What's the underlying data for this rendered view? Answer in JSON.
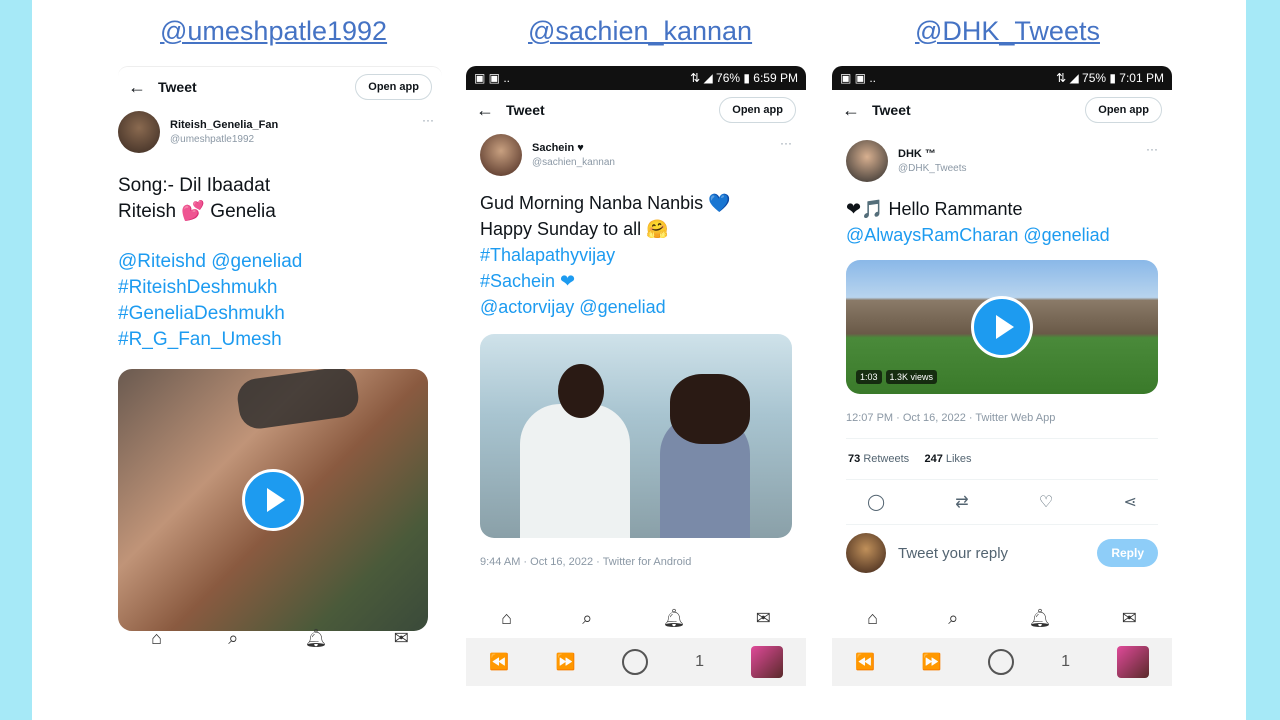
{
  "headings": [
    "@umeshpatle1992",
    "@sachien_kannan",
    "@DHK_Tweets"
  ],
  "panels": [
    {
      "status": null,
      "toolbar": {
        "back": "←",
        "title": "Tweet",
        "open_app": "Open app"
      },
      "author": {
        "name": "Riteish_Genelia_Fan",
        "handle": "@umeshpatle1992"
      },
      "text_lines": [
        "Song:- Dil Ibaadat",
        "Riteish 💕 Genelia"
      ],
      "link_lines": [
        "@Riteishd @geneliad",
        "#RiteishDeshmukh",
        "#GeneliaDeshmukh",
        "#R_G_Fan_Umesh"
      ]
    },
    {
      "status": {
        "left": "▣ ▣ ..",
        "right": "⇅ ◢ 76% ▮ 6:59 PM"
      },
      "toolbar": {
        "back": "←",
        "title": "Tweet",
        "open_app": "Open app"
      },
      "author": {
        "name": "Sachein ♥",
        "handle": "@sachien_kannan"
      },
      "text_lines": [
        "Gud Morning Nanba Nanbis 💙",
        "Happy Sunday to all 🤗"
      ],
      "link_lines": [
        "#Thalapathyvijay",
        "#Sachein ❤",
        "@actorvijay @geneliad"
      ],
      "meta": "9:44 AM · Oct 16, 2022 · Twitter for Android"
    },
    {
      "status": {
        "left": "▣ ▣ ..",
        "right": "⇅ ◢ 75% ▮ 7:01 PM"
      },
      "toolbar": {
        "back": "←",
        "title": "Tweet",
        "open_app": "Open app"
      },
      "author": {
        "name": "DHK ™",
        "handle": "@DHK_Tweets"
      },
      "text_lines": [
        "❤🎵 Hello Rammante"
      ],
      "link_lines": [
        "@AlwaysRamCharan @geneliad"
      ],
      "video_badges": [
        "1:03",
        "1.3K views"
      ],
      "meta": "12:07 PM · Oct 16, 2022 · Twitter Web App",
      "stats": {
        "retweets": "73",
        "retweets_label": "Retweets",
        "likes": "247",
        "likes_label": "Likes"
      },
      "reply_placeholder": "Tweet your reply",
      "reply_button": "Reply"
    }
  ],
  "android_nav": {
    "page_number": "1"
  },
  "icons": {
    "home": "home-icon",
    "search": "search-icon",
    "notifications": "bell-icon",
    "messages": "mail-icon",
    "reply": "reply-icon",
    "retweet": "retweet-icon",
    "like": "heart-icon",
    "share": "share-icon"
  },
  "colors": {
    "link": "#1d9bf0",
    "heading": "#4573c4",
    "side_border": "#a6e9f7"
  }
}
